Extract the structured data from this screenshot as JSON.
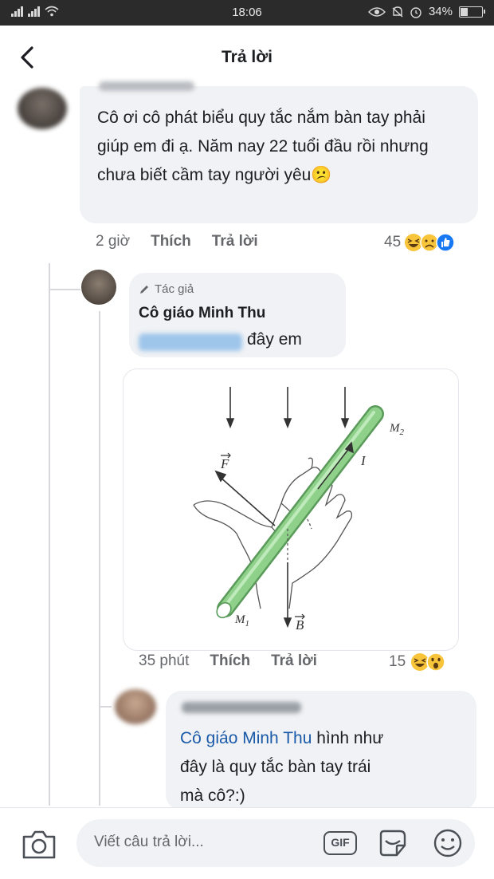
{
  "status_bar": {
    "time": "18:06",
    "battery_percent": "34%",
    "battery_level": 0.34,
    "icons": [
      "signal-icon",
      "signal-icon",
      "wifi-icon",
      "eye-icon",
      "bell-icon",
      "alarm-icon",
      "battery-icon"
    ]
  },
  "header": {
    "back_icon": "chevron-left-icon",
    "title": "Trả lời"
  },
  "comment_main": {
    "text": "Cô ơi cô phát biểu quy tắc nắm bàn tay phải giúp em đi ạ. Năm nay 22 tuổi đầu rồi nhưng chưa biết cầm tay người yêu",
    "emoji": "😕",
    "time": "2 giờ",
    "like_label": "Thích",
    "reply_label": "Trả lời",
    "reaction_count": "45",
    "reactions": [
      "haha",
      "sad",
      "like"
    ]
  },
  "comment_author": {
    "badge_icon": "pencil-icon",
    "badge_label": "Tác giả",
    "name": "Cô giáo Minh Thu",
    "text_suffix": "đây em",
    "time": "35 phút",
    "like_label": "Thích",
    "reply_label": "Trả lời",
    "reaction_count": "15",
    "reactions": [
      "haha",
      "wow"
    ],
    "figure_labels": {
      "f": "F",
      "i": "I",
      "m2": "M",
      "m2_sub": "2",
      "m1": "M",
      "m1_sub": "1",
      "b": "B"
    }
  },
  "comment_reply": {
    "mention": "Cô giáo Minh Thu",
    "text_line1": " hình như",
    "text_line2": "đây là quy tắc bàn tay trái",
    "text_line3": "mà cô?:)"
  },
  "composer": {
    "camera_icon": "camera-icon",
    "placeholder": "Viết câu trả lời...",
    "gif_label": "GIF",
    "sticker_icon": "sticker-icon",
    "emoji_icon": "smiley-icon"
  },
  "colors": {
    "mention": "#1b5aa8",
    "bubble": "#f0f2f5",
    "like": "#1877f2",
    "rod": "#8fd18a"
  }
}
